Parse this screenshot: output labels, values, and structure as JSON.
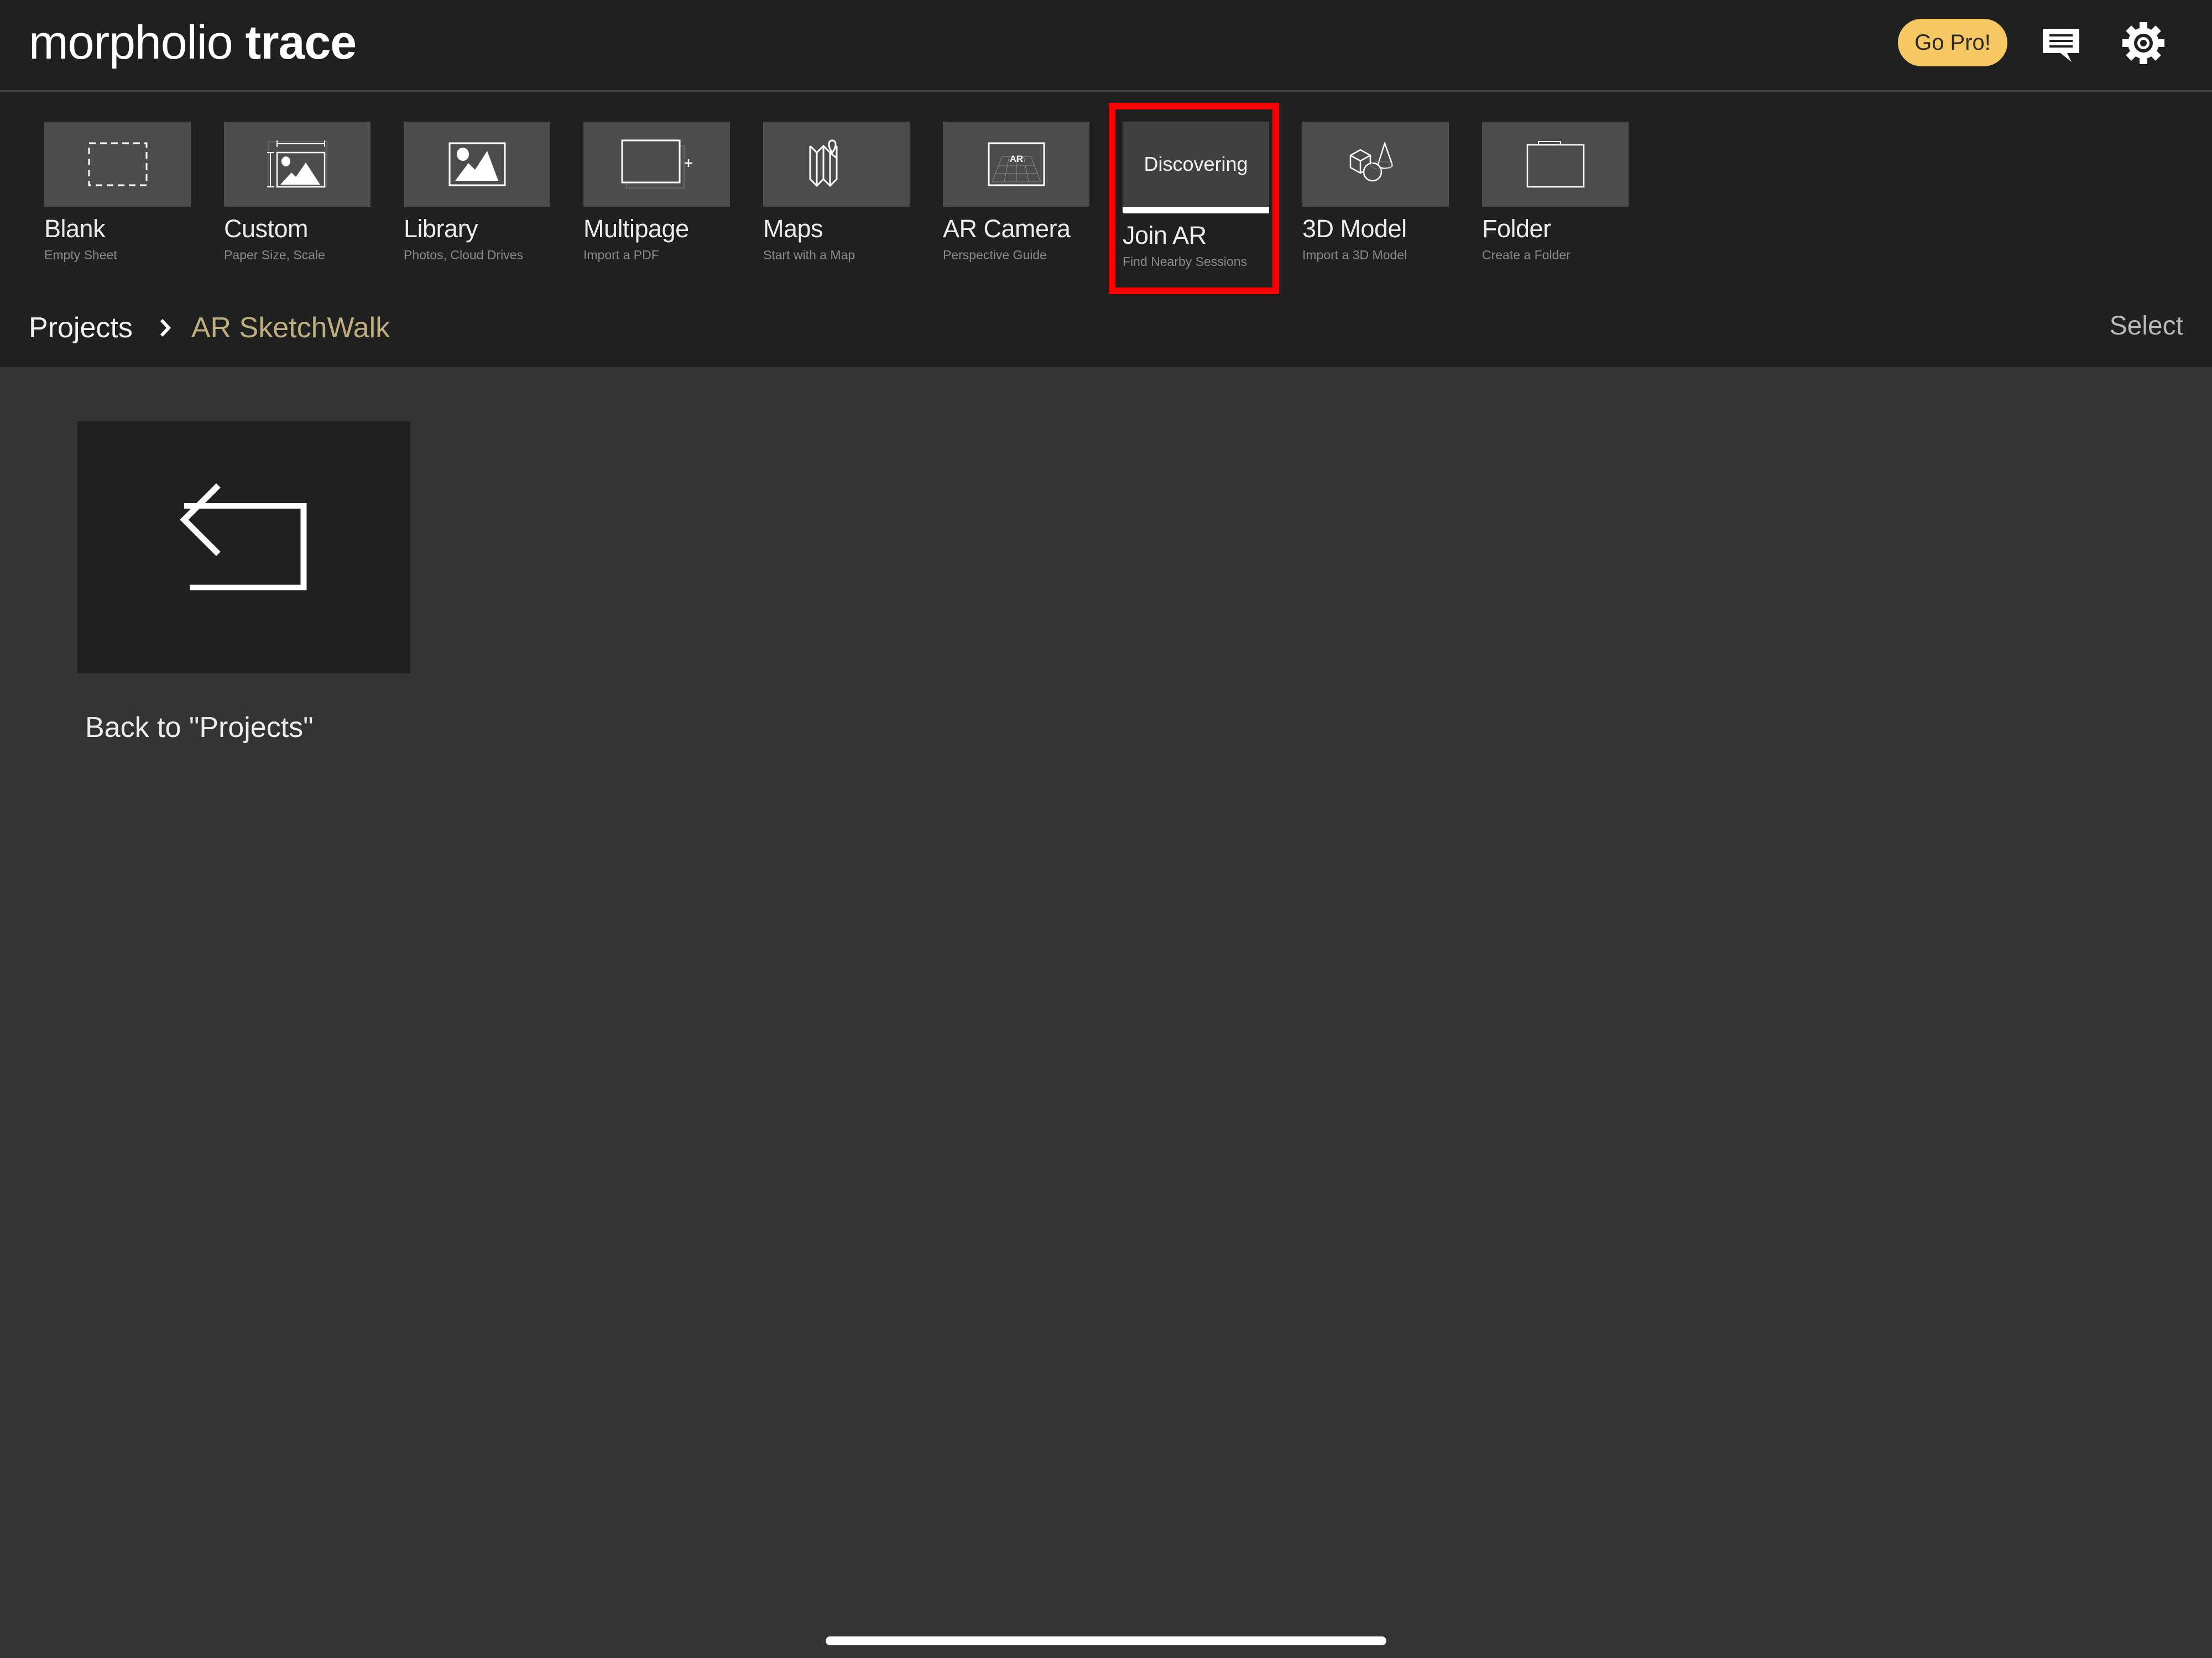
{
  "app": {
    "logo_light": "morpholio",
    "logo_bold": "trace"
  },
  "header": {
    "go_pro_label": "Go Pro!",
    "feedback_icon": "chat-bubble-icon",
    "settings_icon": "gear-icon",
    "accent_color": "#f5c862"
  },
  "tiles": [
    {
      "label": "Blank",
      "sub": "Empty Sheet",
      "icon": "dashed-rectangle-icon"
    },
    {
      "label": "Custom",
      "sub": "Paper Size, Scale",
      "icon": "custom-size-image-icon"
    },
    {
      "label": "Library",
      "sub": "Photos, Cloud Drives",
      "icon": "image-icon"
    },
    {
      "label": "Multipage",
      "sub": "Import a PDF",
      "icon": "multipage-icon"
    },
    {
      "label": "Maps",
      "sub": "Start with a Map",
      "icon": "folded-map-icon"
    },
    {
      "label": "AR Camera",
      "sub": "Perspective Guide",
      "icon": "ar-grid-icon",
      "icon_text": "AR"
    },
    {
      "label": "Join AR",
      "sub": "Find Nearby Sessions",
      "status": "Discovering",
      "progress": 1.0,
      "highlighted": true
    },
    {
      "label": "3D Model",
      "sub": "Import a 3D Model",
      "icon": "3d-shapes-icon"
    },
    {
      "label": "Folder",
      "sub": "Create a Folder",
      "icon": "folder-icon"
    }
  ],
  "breadcrumb": {
    "root": "Projects",
    "separator_icon": "chevron-right-icon",
    "current": "AR SketchWalk",
    "current_color": "#bfae7e"
  },
  "select_label": "Select",
  "content": {
    "back_card": {
      "caption": "Back to \"Projects\"",
      "icon": "return-arrow-icon"
    }
  },
  "highlight_color": "#ff0000"
}
